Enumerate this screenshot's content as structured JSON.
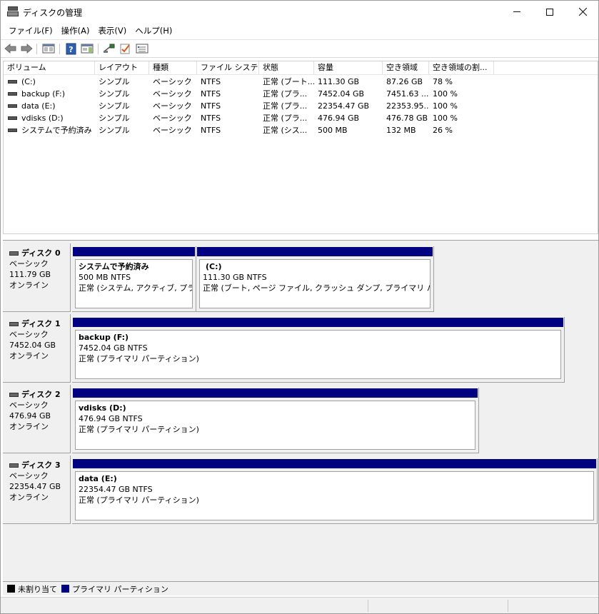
{
  "window": {
    "title": "ディスクの管理"
  },
  "menu": [
    "ファイル(F)",
    "操作(A)",
    "表示(V)",
    "ヘルプ(H)"
  ],
  "toolbar": {
    "icons": [
      "back-arrow-icon",
      "forward-arrow-icon",
      "properties-view-icon",
      "help-icon",
      "action-pane-icon",
      "connect-icon",
      "check-icon",
      "list-settings-icon"
    ]
  },
  "volume_list": {
    "columns": [
      "ボリューム",
      "レイアウト",
      "種類",
      "ファイル システム",
      "状態",
      "容量",
      "空き領域",
      "空き領域の割..."
    ],
    "rows": [
      [
        "(C:)",
        "シンプル",
        "ベーシック",
        "NTFS",
        "正常 (ブート...",
        "111.30 GB",
        "87.26 GB",
        "78 %"
      ],
      [
        "backup (F:)",
        "シンプル",
        "ベーシック",
        "NTFS",
        "正常 (プラ...",
        "7452.04 GB",
        "7451.63 ...",
        "100 %"
      ],
      [
        "data (E:)",
        "シンプル",
        "ベーシック",
        "NTFS",
        "正常 (プラ...",
        "22354.47 GB",
        "22353.95...",
        "100 %"
      ],
      [
        "vdisks (D:)",
        "シンプル",
        "ベーシック",
        "NTFS",
        "正常 (プラ...",
        "476.94 GB",
        "476.78 GB",
        "100 %"
      ],
      [
        "システムで予約済み",
        "シンプル",
        "ベーシック",
        "NTFS",
        "正常 (シス...",
        "500 MB",
        "132 MB",
        "26 %"
      ]
    ]
  },
  "disks": [
    {
      "name": "ディスク 0",
      "type": "ベーシック",
      "size": "111.79 GB",
      "status": "オンライン",
      "partitions": [
        {
          "name": "システムで予約済み",
          "size": "500 MB NTFS",
          "status": "正常 (システム, アクティブ, プライマリ パーティション)"
        },
        {
          "name": "(C:)",
          "size": "111.30 GB NTFS",
          "status": "正常 (ブート, ページ ファイル, クラッシュ ダンプ, プライマリ パーティション)"
        }
      ]
    },
    {
      "name": "ディスク 1",
      "type": "ベーシック",
      "size": "7452.04 GB",
      "status": "オンライン",
      "partitions": [
        {
          "name": "backup  (F:)",
          "size": "7452.04 GB NTFS",
          "status": "正常 (プライマリ パーティション)"
        }
      ]
    },
    {
      "name": "ディスク 2",
      "type": "ベーシック",
      "size": "476.94 GB",
      "status": "オンライン",
      "partitions": [
        {
          "name": "vdisks  (D:)",
          "size": "476.94 GB NTFS",
          "status": "正常 (プライマリ パーティション)"
        }
      ]
    },
    {
      "name": "ディスク 3",
      "type": "ベーシック",
      "size": "22354.47 GB",
      "status": "オンライン",
      "partitions": [
        {
          "name": "data  (E:)",
          "size": "22354.47 GB NTFS",
          "status": "正常 (プライマリ パーティション)"
        }
      ]
    }
  ],
  "legend": [
    {
      "label": "未割り当て",
      "color": "#000000"
    },
    {
      "label": "プライマリ パーティション",
      "color": "#000080"
    }
  ],
  "colors": {
    "partition_bar": "#000080",
    "pane_bg": "#f0f0f0"
  }
}
